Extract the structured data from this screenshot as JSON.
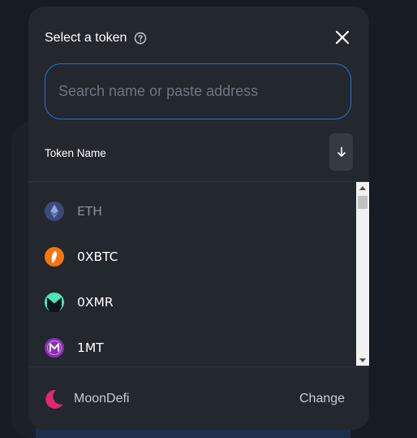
{
  "modal": {
    "title": "Select a token",
    "search_placeholder": "Search name or paste address",
    "search_value": "",
    "column_header": "Token Name",
    "sort_icon": "arrow-down-icon"
  },
  "tokens": [
    {
      "symbol": "ETH",
      "icon": "ethereum-icon",
      "color": "#627eea",
      "disabled": true
    },
    {
      "symbol": "0XBTC",
      "icon": "0xbitcoin-icon",
      "color": "#f5750b",
      "disabled": false
    },
    {
      "symbol": "0XMR",
      "icon": "0xmonero-icon",
      "color": "#4ce5b5",
      "disabled": false
    },
    {
      "symbol": "1MT",
      "icon": "1million-icon",
      "color": "#8c2fb3",
      "disabled": false
    }
  ],
  "footer": {
    "list_name": "MoonDefi",
    "change_label": "Change",
    "logo_icon": "crescent-moon-icon",
    "logo_color": "#e0286f"
  },
  "colors": {
    "accent": "#2a6fd6",
    "modal_bg": "#23272e"
  }
}
